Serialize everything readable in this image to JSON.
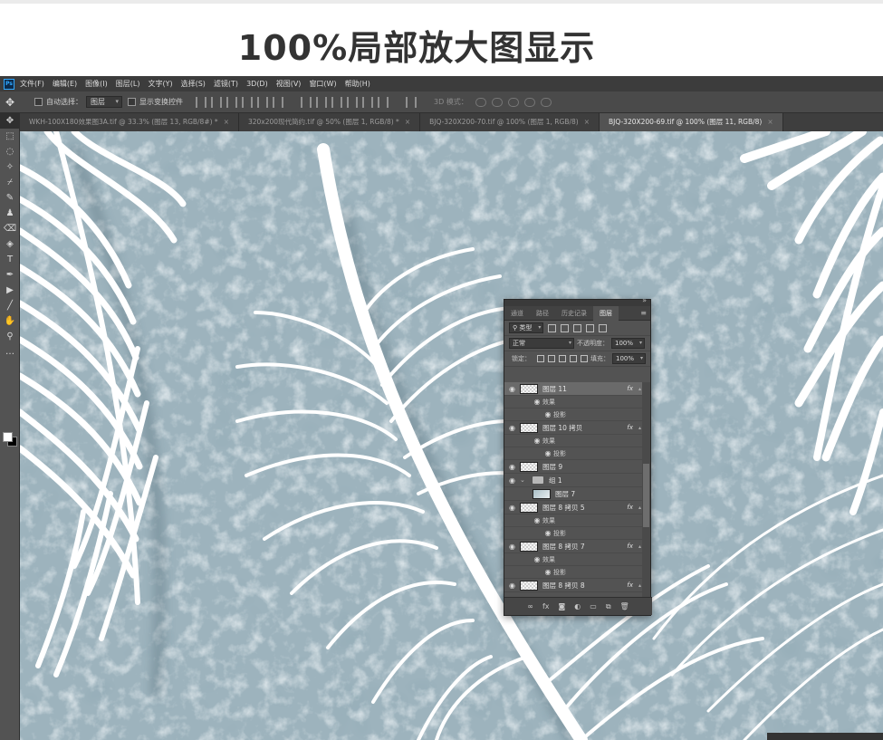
{
  "hero": {
    "title": "100%局部放大图显示"
  },
  "colors": {
    "ps_panel": "#535353",
    "ps_bar": "#3c3c3c",
    "accent": "#31a8ff",
    "texture_base": "#9db3bd",
    "feather": "#ffffff"
  },
  "menubar": {
    "logo": "Ps",
    "items": [
      "文件(F)",
      "编辑(E)",
      "图像(I)",
      "图层(L)",
      "文字(Y)",
      "选择(S)",
      "滤镜(T)",
      "3D(D)",
      "视图(V)",
      "窗口(W)",
      "帮助(H)"
    ]
  },
  "options": {
    "auto_select_label": "自动选择：",
    "auto_select_value": "图层",
    "show_transform_label": "显示变换控件",
    "mode_3d_label": "3D 模式："
  },
  "tabs": [
    {
      "label": "WKH-100X180效果图3A.tif @ 33.3% (图层 13, RGB/8#) *",
      "close": "×"
    },
    {
      "label": "320x200现代简约.tif @ 50% (图层 1, RGB/8) *",
      "close": "×"
    },
    {
      "label": "BJQ-320X200-70.tif @ 100% (图层 1, RGB/8)",
      "close": "×"
    },
    {
      "label": "BJQ-320X200-69.tif @ 100% (图层 11, RGB/8)",
      "close": "×"
    }
  ],
  "tools": [
    "move-icon",
    "marquee-icon",
    "lasso-icon",
    "magic-wand-icon",
    "eyedropper-icon",
    "brush-icon",
    "stamp-icon",
    "eraser-icon",
    "bucket-icon",
    "text-icon",
    "pen-icon",
    "path-select-icon",
    "line-icon",
    "hand-icon",
    "zoom-icon",
    "more-icon"
  ],
  "layers_panel": {
    "tabs": [
      "通道",
      "路径",
      "历史记录",
      "图层"
    ],
    "active_tab": "图层",
    "filter_kind": "类型",
    "blend_mode": "正常",
    "opacity_label": "不透明度：",
    "opacity_value": "100%",
    "lock_label": "锁定：",
    "fill_label": "填充：",
    "fill_value": "100%",
    "fx_symbol": "fx",
    "effect_label": "效果",
    "shadow_label": "投影",
    "layers": [
      {
        "name": "图层 11",
        "selected": true,
        "visible": true
      },
      {
        "name": "图层 10 拷贝",
        "visible": true
      },
      {
        "name": "图层 9",
        "visible": true
      },
      {
        "name": "组 1",
        "visible": true
      },
      {
        "name": "图层 7",
        "visible": false
      },
      {
        "name": "图层 8 拷贝 5",
        "visible": true
      },
      {
        "name": "图层 8 拷贝 7",
        "visible": true
      },
      {
        "name": "图层 8 拷贝 8",
        "visible": true
      }
    ]
  }
}
